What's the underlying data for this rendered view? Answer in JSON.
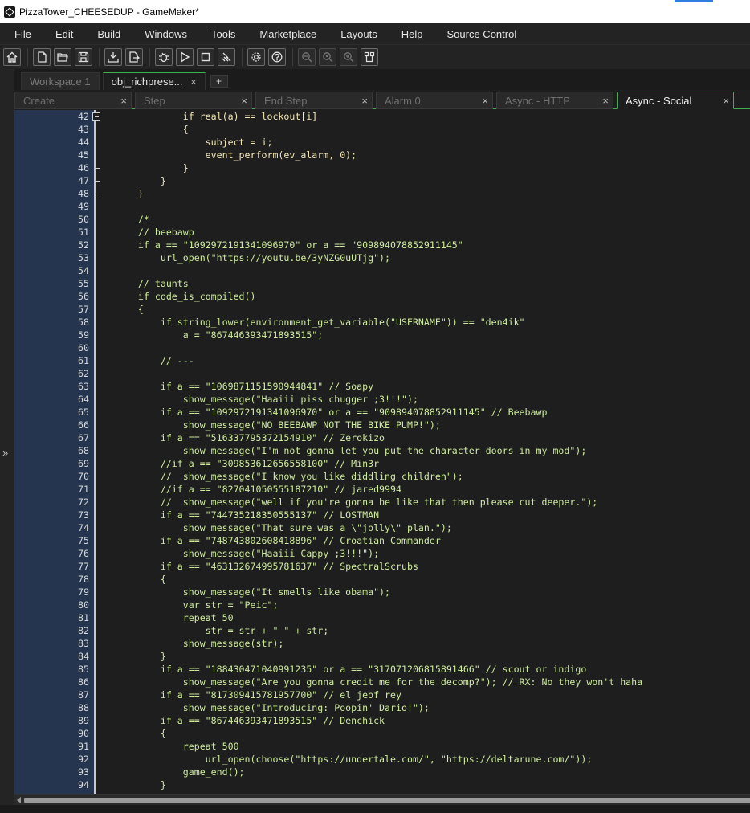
{
  "window": {
    "title": "PizzaTower_CHEESEDUP - GameMaker*"
  },
  "menu": [
    "File",
    "Edit",
    "Build",
    "Windows",
    "Tools",
    "Marketplace",
    "Layouts",
    "Help",
    "Source Control"
  ],
  "toolbar": {
    "icons": [
      "home-icon",
      "new-project-icon",
      "open-project-icon",
      "save-icon",
      "create-executable-icon",
      "export-icon",
      "debug-icon",
      "run-icon",
      "stop-icon",
      "clean-icon",
      "settings-icon",
      "help-icon",
      "zoom-out-icon",
      "zoom-reset-icon",
      "zoom-in-icon",
      "layout-icon"
    ]
  },
  "workspace_tabs": [
    {
      "label": "Workspace 1",
      "active": false
    },
    {
      "label": "obj_richprese...",
      "active": true
    }
  ],
  "workspace_add": "+",
  "event_tabs": [
    {
      "label": "Create",
      "active": false
    },
    {
      "label": "Step",
      "active": false
    },
    {
      "label": "End Step",
      "active": false
    },
    {
      "label": "Alarm 0",
      "active": false
    },
    {
      "label": "Async - HTTP",
      "active": false
    },
    {
      "label": "Async - Social",
      "active": true
    }
  ],
  "close_glyph": "×",
  "sidebar": {
    "expand_label": "»"
  },
  "code_lines": [
    {
      "n": "42",
      "text": "            if real(a) == lockout[i]",
      "style": "plain",
      "fold": "box"
    },
    {
      "n": "43",
      "text": "            {",
      "style": "plain"
    },
    {
      "n": "44",
      "text": "                subject = i;",
      "style": "plain"
    },
    {
      "n": "45",
      "text": "                event_perform(ev_alarm, 0);",
      "style": "plain"
    },
    {
      "n": "46",
      "text": "            }",
      "style": "plain",
      "fold": "end"
    },
    {
      "n": "47",
      "text": "        }",
      "style": "plain",
      "fold": "end"
    },
    {
      "n": "48",
      "text": "    }",
      "style": "plain",
      "fold": "end"
    },
    {
      "n": "49",
      "text": "",
      "style": "plain"
    },
    {
      "n": "50",
      "text": "    /*",
      "style": "comment"
    },
    {
      "n": "51",
      "text": "    // beebawp",
      "style": "comment"
    },
    {
      "n": "52",
      "text": "    if a == \"1092972191341096970\" or a == \"909894078852911145\"",
      "style": "comment"
    },
    {
      "n": "53",
      "text": "        url_open(\"https://youtu.be/3yNZG0uUTjg\");",
      "style": "comment"
    },
    {
      "n": "54",
      "text": "",
      "style": "comment"
    },
    {
      "n": "55",
      "text": "    // taunts",
      "style": "comment"
    },
    {
      "n": "56",
      "text": "    if code_is_compiled()",
      "style": "comment"
    },
    {
      "n": "57",
      "text": "    {",
      "style": "comment"
    },
    {
      "n": "58",
      "text": "        if string_lower(environment_get_variable(\"USERNAME\")) == \"den4ik\"",
      "style": "comment"
    },
    {
      "n": "59",
      "text": "            a = \"867446393471893515\";",
      "style": "comment"
    },
    {
      "n": "60",
      "text": "",
      "style": "comment"
    },
    {
      "n": "61",
      "text": "        // ---",
      "style": "comment"
    },
    {
      "n": "62",
      "text": "",
      "style": "comment"
    },
    {
      "n": "63",
      "text": "        if a == \"1069871151590944841\" // Soapy",
      "style": "comment"
    },
    {
      "n": "64",
      "text": "            show_message(\"Haaiii piss chugger ;3!!!\");",
      "style": "comment"
    },
    {
      "n": "65",
      "text": "        if a == \"1092972191341096970\" or a == \"909894078852911145\" // Beebawp",
      "style": "comment"
    },
    {
      "n": "66",
      "text": "            show_message(\"NO BEEBAWP NOT THE BIKE PUMP!\");",
      "style": "comment"
    },
    {
      "n": "67",
      "text": "        if a == \"516337795372154910\" // Zerokizo",
      "style": "comment"
    },
    {
      "n": "68",
      "text": "            show_message(\"I'm not gonna let you put the character doors in my mod\");",
      "style": "comment"
    },
    {
      "n": "69",
      "text": "        //if a == \"309853612656558100\" // Min3r",
      "style": "comment"
    },
    {
      "n": "70",
      "text": "        //  show_message(\"I know you like diddling children\");",
      "style": "comment"
    },
    {
      "n": "71",
      "text": "        //if a == \"827041050555187210\" // jared9994",
      "style": "comment"
    },
    {
      "n": "72",
      "text": "        //  show_message(\"well if you're gonna be like that then please cut deeper.\");",
      "style": "comment"
    },
    {
      "n": "73",
      "text": "        if a == \"744735218350555137\" // LOSTMAN",
      "style": "comment"
    },
    {
      "n": "74",
      "text": "            show_message(\"That sure was a \\\"jolly\\\" plan.\");",
      "style": "comment"
    },
    {
      "n": "75",
      "text": "        if a == \"748743802608418896\" // Croatian Commander",
      "style": "comment"
    },
    {
      "n": "76",
      "text": "            show_message(\"Haaiii Cappy ;3!!!\");",
      "style": "comment"
    },
    {
      "n": "77",
      "text": "        if a == \"463132674995781637\" // SpectralScrubs",
      "style": "comment"
    },
    {
      "n": "78",
      "text": "        {",
      "style": "comment"
    },
    {
      "n": "79",
      "text": "            show_message(\"It smells like obama\");",
      "style": "comment"
    },
    {
      "n": "80",
      "text": "            var str = \"Peic\";",
      "style": "comment"
    },
    {
      "n": "81",
      "text": "            repeat 50",
      "style": "comment"
    },
    {
      "n": "82",
      "text": "                str = str + \" \" + str;",
      "style": "comment"
    },
    {
      "n": "83",
      "text": "            show_message(str);",
      "style": "comment"
    },
    {
      "n": "84",
      "text": "        }",
      "style": "comment"
    },
    {
      "n": "85",
      "text": "        if a == \"188430471040991235\" or a == \"317071206815891466\" // scout or indigo",
      "style": "comment"
    },
    {
      "n": "86",
      "text": "            show_message(\"Are you gonna credit me for the decomp?\"); // RX: No they won't haha",
      "style": "comment"
    },
    {
      "n": "87",
      "text": "        if a == \"817309415781957700\" // el jeof rey",
      "style": "comment"
    },
    {
      "n": "88",
      "text": "            show_message(\"Introducing: Poopin' Dario!\");",
      "style": "comment"
    },
    {
      "n": "89",
      "text": "        if a == \"867446393471893515\" // Denchick",
      "style": "comment"
    },
    {
      "n": "90",
      "text": "        {",
      "style": "comment"
    },
    {
      "n": "91",
      "text": "            repeat 500",
      "style": "comment"
    },
    {
      "n": "92",
      "text": "                url_open(choose(\"https://undertale.com/\", \"https://deltarune.com/\"));",
      "style": "comment"
    },
    {
      "n": "93",
      "text": "            game_end();",
      "style": "comment"
    },
    {
      "n": "94",
      "text": "        }",
      "style": "comment"
    }
  ],
  "colors": {
    "gutter": "#26354f",
    "accent_tab": "#3db04f",
    "comment_text": "#cdeb9c",
    "code_text": "#f2e6b5"
  }
}
